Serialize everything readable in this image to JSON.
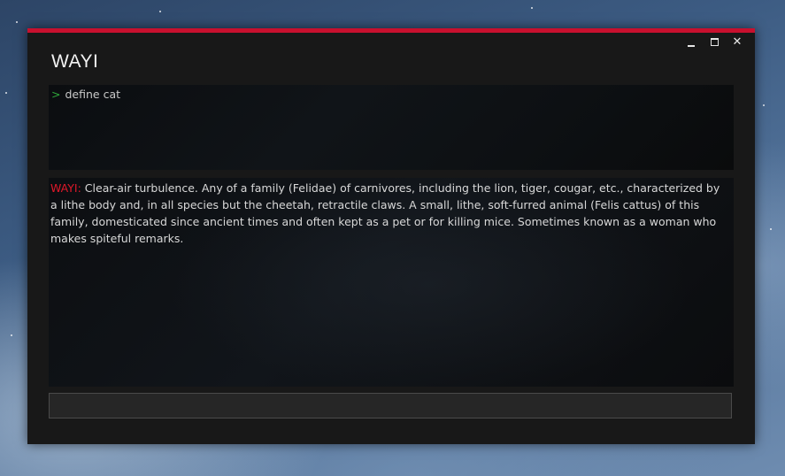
{
  "window": {
    "title": "WAYI",
    "accent_color": "#c8102e",
    "controls": {
      "minimize_icon": "minimize-icon",
      "maximize_icon": "maximize-icon",
      "close_icon": "close-icon",
      "close_glyph": "✕"
    }
  },
  "command": {
    "prompt": ">",
    "text": "define cat"
  },
  "response": {
    "label": "WAYI:",
    "text": "Clear-air turbulence. Any of a family (Felidae) of carnivores, including the lion, tiger, cougar, etc., characterized by a lithe body and, in all species but the cheetah, retractile claws. A small, lithe, soft-furred animal (Felis cattus) of this family, domesticated since ancient times and often kept as a pet or for killing mice. Sometimes known as a woman who makes spiteful remarks."
  },
  "input": {
    "value": "",
    "placeholder": ""
  }
}
